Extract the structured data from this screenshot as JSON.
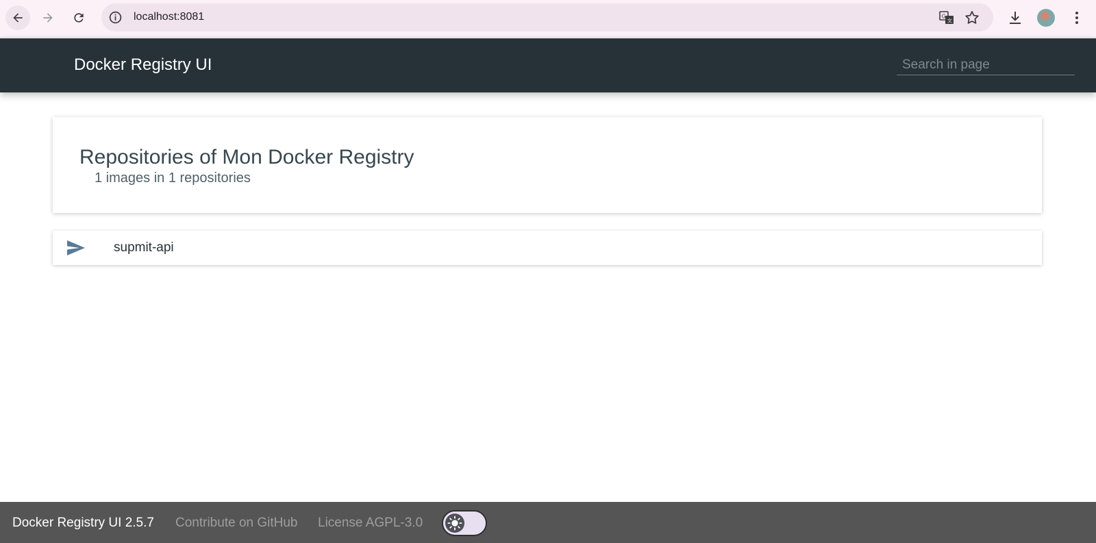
{
  "browser": {
    "url": "localhost:8081",
    "icons": [
      "back-arrow-icon",
      "forward-arrow-icon",
      "reload-icon",
      "site-info-icon",
      "translate-icon",
      "star-icon",
      "download-icon",
      "kebab-menu-icon"
    ]
  },
  "header": {
    "title": "Docker Registry UI",
    "search_placeholder": "Search in page",
    "background": "#263238"
  },
  "main": {
    "title": "Repositories of Mon Docker Registry",
    "subtitle": "1 images in 1 repositories",
    "repositories": [
      {
        "name": "supmit-api",
        "icon": "send-icon"
      }
    ]
  },
  "footer": {
    "version": "Docker Registry UI 2.5.7",
    "github_link": "Contribute on GitHub",
    "license_link": "License AGPL-3.0",
    "theme_toggle_icon": "sun-icon",
    "background": "#555555"
  }
}
